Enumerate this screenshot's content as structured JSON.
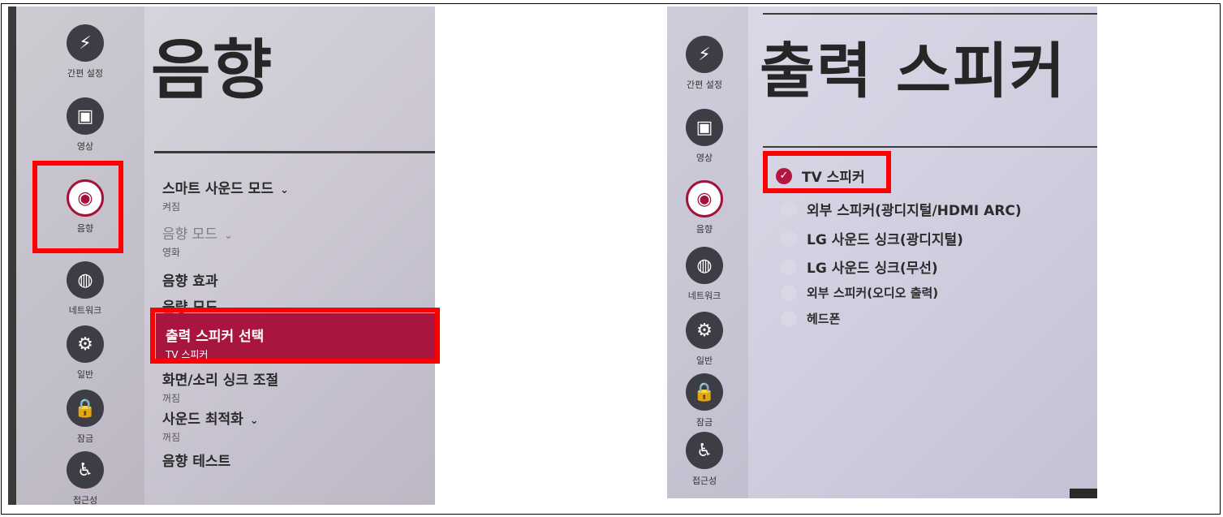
{
  "left_panel": {
    "title": "음향",
    "sidebar": [
      {
        "icon": "lightning-icon",
        "glyph": "⚡",
        "label": "간편 설정"
      },
      {
        "icon": "picture-icon",
        "glyph": "▣",
        "label": "영상"
      },
      {
        "icon": "sound-icon",
        "glyph": "◉",
        "label": "음향"
      },
      {
        "icon": "network-icon",
        "glyph": "◍",
        "label": "네트워크"
      },
      {
        "icon": "tools-icon",
        "glyph": "⚙",
        "label": "일반"
      },
      {
        "icon": "lock-icon",
        "glyph": "🔒",
        "label": "잠금"
      },
      {
        "icon": "accessibility-icon",
        "glyph": "♿",
        "label": "접근성"
      }
    ],
    "menu": [
      {
        "label": "스마트 사운드 모드",
        "sub": "켜짐",
        "chevron": "⌄"
      },
      {
        "label": "음향 모드",
        "sub": "영화",
        "chevron": "⌄"
      },
      {
        "label": "음향 효과",
        "sub": ""
      },
      {
        "label": "음량 모드",
        "sub": ""
      },
      {
        "label": "출력 스피커 선택",
        "sub": "TV 스피커"
      },
      {
        "label": "화면/소리 싱크 조절",
        "sub": "꺼짐"
      },
      {
        "label": "사운드 최적화",
        "sub": "꺼짐",
        "chevron": "⌄"
      },
      {
        "label": "음향 테스트",
        "sub": ""
      }
    ]
  },
  "right_panel": {
    "title": "출력 스피커",
    "sidebar": [
      {
        "icon": "lightning-icon",
        "glyph": "⚡",
        "label": "간편 설정"
      },
      {
        "icon": "picture-icon",
        "glyph": "▣",
        "label": "영상"
      },
      {
        "icon": "sound-icon",
        "glyph": "◉",
        "label": "음향"
      },
      {
        "icon": "network-icon",
        "glyph": "◍",
        "label": "네트워크"
      },
      {
        "icon": "tools-icon",
        "glyph": "⚙",
        "label": "일반"
      },
      {
        "icon": "lock-icon",
        "glyph": "🔒",
        "label": "잠금"
      },
      {
        "icon": "accessibility-icon",
        "glyph": "♿",
        "label": "접근성"
      }
    ],
    "options": [
      {
        "label": "TV 스피커",
        "checked": true,
        "check_glyph": "✓"
      },
      {
        "label": "외부 스피커(광디지털/HDMI ARC)",
        "checked": false
      },
      {
        "label": "LG 사운드 싱크(광디지털)",
        "checked": false
      },
      {
        "label": "LG 사운드 싱크(무선)",
        "checked": false
      },
      {
        "label": "외부 스피커(오디오 출력)",
        "checked": false
      },
      {
        "label": "헤드폰",
        "checked": false
      }
    ]
  },
  "colors": {
    "accent": "#a8163f",
    "highlight_box": "#ff0000"
  }
}
